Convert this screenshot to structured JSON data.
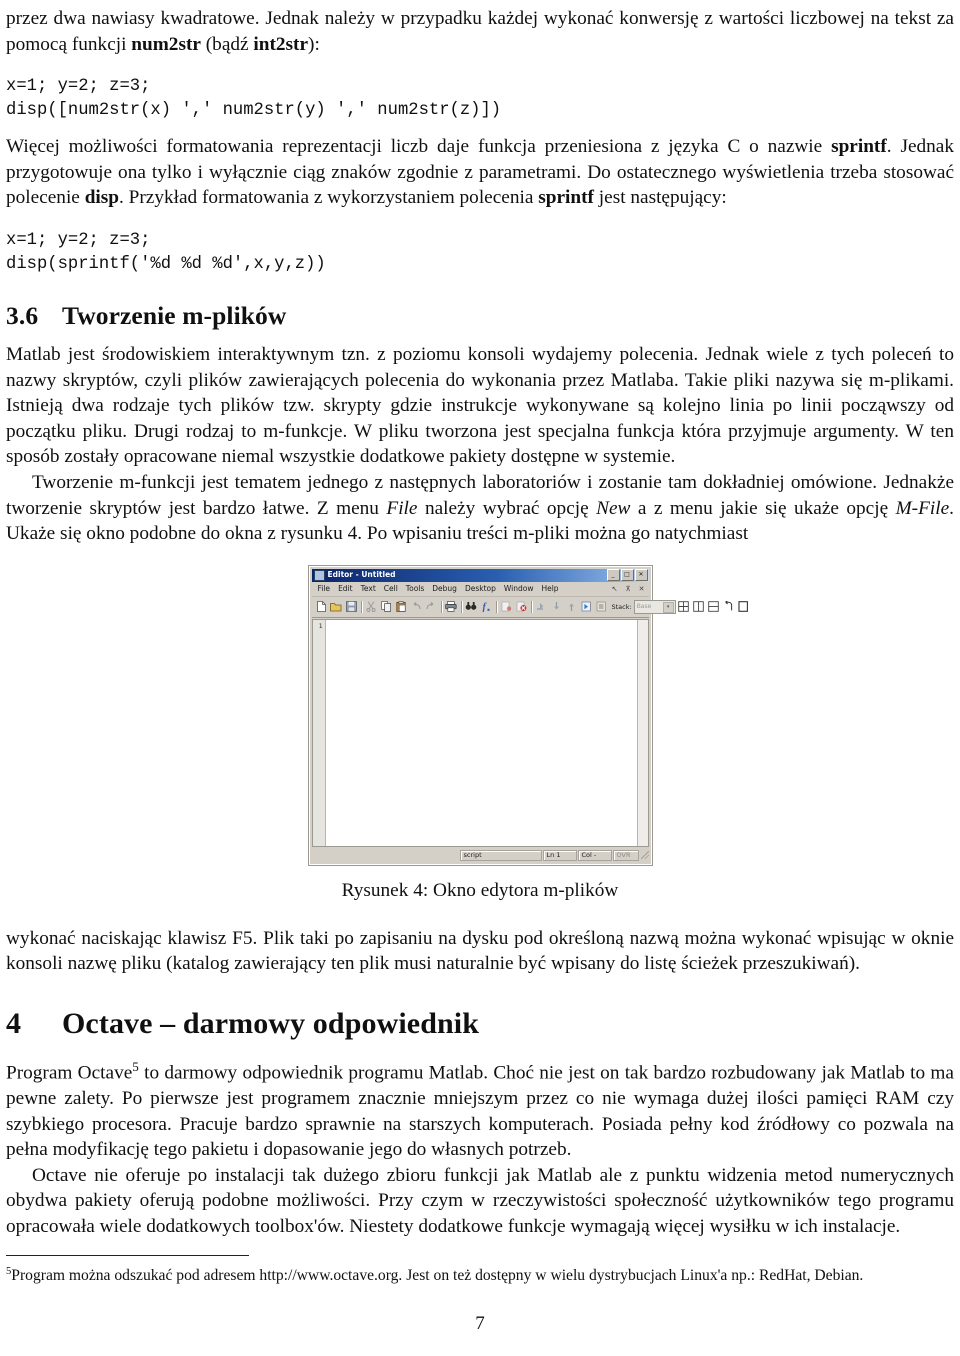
{
  "document": {
    "page_number": "7",
    "language": "pl"
  },
  "paragraphs": {
    "p1_part1": "przez dwa nawiasy kwadratowe. ",
    "p1_part2": "Jednak należy w przypadku każdej wykonać konwersję z wartości liczbowej na tekst za pomocą funkcji ",
    "p1_bold1": "num2str",
    "p1_part3": " (bądź ",
    "p1_bold2": "int2str",
    "p1_part4": "):",
    "code1": "x=1; y=2; z=3;\ndisp([num2str(x) ',' num2str(y) ',' num2str(z)])",
    "p2_part1": "Więcej możliwości formatowania reprezentacji liczb daje funkcja przeniesiona z języka C o nazwie ",
    "p2_bold1": "sprintf",
    "p2_part2": ". Jednak przygotowuje ona tylko i wyłącznie ciąg znaków zgodnie z parametrami. Do ostatecznego wyświetlenia trzeba stosować polecenie ",
    "p2_bold2": "disp",
    "p2_part3": ". Przykład formatowania z wykorzystaniem polecenia ",
    "p2_bold3": "sprintf",
    "p2_part4": " jest następujący:",
    "code2": "x=1; y=2; z=3;\ndisp(sprintf('%d %d %d',x,y,z))",
    "section36_number": "3.6",
    "section36_title": "Tworzenie m-plików",
    "p3": "Matlab jest środowiskiem interaktywnym tzn. z poziomu konsoli wydajemy polecenia. Jednak wiele z tych poleceń to nazwy skryptów, czyli plików zawierających polecenia do wykonania przez Matlaba. Takie pliki nazywa się m-plikami. Istnieją dwa rodzaje tych plików tzw. skrypty gdzie instrukcje wykonywane są kolejno linia po linii począwszy od początku pliku. Drugi rodzaj to m-funkcje. W pliku tworzona jest specjalna funkcja która przyjmuje argumenty. W ten sposób zostały opracowane niemal wszystkie dodatkowe pakiety dostępne w systemie.",
    "p4_part1": "Tworzenie m-funkcji jest tematem jednego z następnych laboratoriów i zostanie tam dokładniej omówione. Jednakże tworzenie skryptów jest bardzo łatwe. Z menu ",
    "p4_it1": "File",
    "p4_part2": " należy wybrać opcję ",
    "p4_it2": "New",
    "p4_part3": " a z menu jakie się ukaże opcję ",
    "p4_it3": "M-File",
    "p4_part4": ". Ukaże się okno podobne do okna z rysunku 4. Po wpisaniu treści m-pliki można go natychmiast",
    "figure_caption": "Rysunek 4: Okno edytora m-plików",
    "p5": "wykonać naciskając klawisz F5. Plik taki po zapisaniu na dysku pod określoną nazwą można wykonać wpisując w oknie konsoli nazwę pliku (katalog zawierający ten plik musi naturalnie być wpisany do listę ścieżek przeszukiwań).",
    "section4_number": "4",
    "section4_title": "Octave – darmowy odpowiednik",
    "p6_part1": "Program Octave",
    "p6_sup": "5",
    "p6_part2": " to darmowy odpowiednik programu Matlab. Choć nie jest on tak bardzo rozbudowany jak Matlab to ma pewne zalety. Po pierwsze jest programem znacznie mniejszym przez co nie wymaga dużej ilości pamięci RAM czy szybkiego procesora. Pracuje bardzo sprawnie na starszych komputerach. Posiada pełny kod źródłowy co pozwala na pełna modyfikację tego pakietu i dopasowanie jego do własnych potrzeb.",
    "p7": "Octave nie oferuje po instalacji tak dużego zbioru funkcji jak Matlab ale z punktu widzenia metod numerycznych obydwa pakiety oferują podobne możliwości. Przy czym w rzeczywistości społeczność użytkowników tego programu opracowała wiele dodatkowych toolbox'ów. Niestety dodatkowe funkcje wymagają więcej wysiłku w ich instalacje.",
    "footnote_marker": "5",
    "footnote_text": "Program można odszukać pod adresem http://www.octave.org. Jest on też dostępny w wielu dystrybucjach Linux'a np.: RedHat, Debian."
  },
  "editor_window": {
    "title": "Editor - Untitled",
    "window_buttons": [
      "_",
      "□",
      "✕"
    ],
    "menu": [
      "File",
      "Edit",
      "Text",
      "Cell",
      "Tools",
      "Debug",
      "Desktop",
      "Window",
      "Help"
    ],
    "menu_right": [
      "↖",
      "⊼",
      "✕"
    ],
    "toolbar_icons": [
      "new-file-icon",
      "open-file-icon",
      "save-file-icon",
      "cut-icon",
      "copy-icon",
      "paste-icon",
      "undo-icon",
      "redo-icon",
      "print-icon",
      "find-icon",
      "function-browser-icon",
      "set-breakpoint-icon",
      "clear-breakpoints-icon",
      "step-icon",
      "step-in-icon",
      "step-out-icon",
      "continue-icon",
      "exit-debug-icon",
      "tile-icon",
      "split-vertical-icon",
      "split-horizontal-icon",
      "undock-icon",
      "maximize-pane-icon"
    ],
    "stack_label": "Stack:",
    "stack_value": "Base",
    "gutter_line_numbers": [
      "1"
    ],
    "editor_text": "",
    "status": {
      "file_type": "script",
      "line_label": "Ln",
      "line_value": "1",
      "col_label": "Col",
      "col_value": "-",
      "overwrite": "OVR"
    }
  },
  "colors": {
    "titlebar_start": "#0a246a",
    "titlebar_end": "#c8dcf4",
    "chrome": "#d4d0c8",
    "chrome_border": "#9a9a92",
    "paper": "#ffffff",
    "ink": "#101010"
  }
}
